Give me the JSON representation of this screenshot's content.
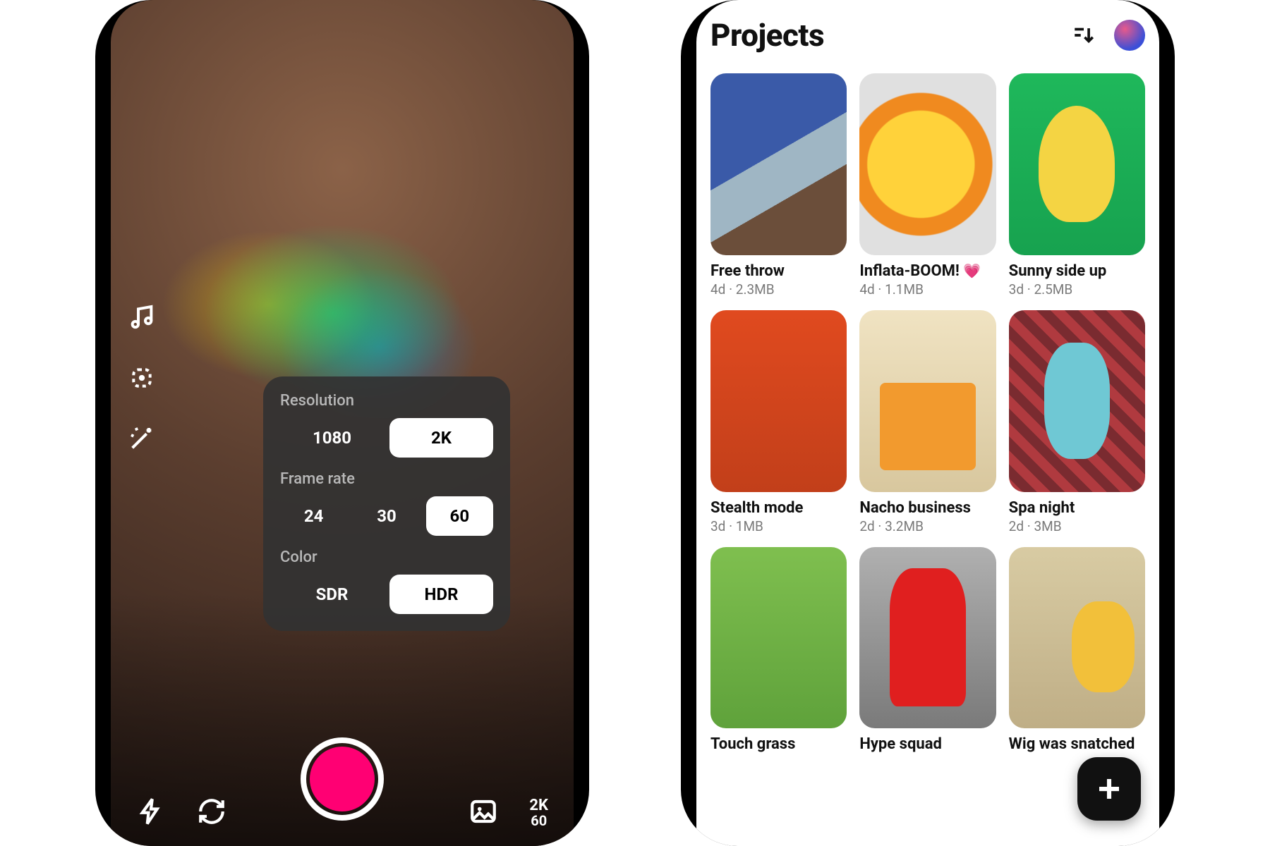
{
  "camera": {
    "sideTools": [
      "music",
      "crop-selection",
      "magic-wand"
    ],
    "settings": {
      "resolution": {
        "label": "Resolution",
        "options": [
          "1080",
          "2K"
        ],
        "selected": "2K"
      },
      "frameRate": {
        "label": "Frame rate",
        "options": [
          "24",
          "30",
          "60"
        ],
        "selected": "60"
      },
      "color": {
        "label": "Color",
        "options": [
          "SDR",
          "HDR"
        ],
        "selected": "HDR"
      }
    },
    "bottomBar": {
      "flash": "flash-icon",
      "flip": "flip-camera-icon",
      "gallery": "gallery-icon",
      "quality": {
        "line1": "2K",
        "line2": "60"
      }
    }
  },
  "projects": {
    "title": "Projects",
    "items": [
      {
        "title": "Free throw",
        "age": "4d",
        "size": "2.3MB",
        "emoji": ""
      },
      {
        "title": "Inflata-BOOM!",
        "age": "4d",
        "size": "1.1MB",
        "emoji": "💗"
      },
      {
        "title": "Sunny side up",
        "age": "3d",
        "size": "2.5MB",
        "emoji": ""
      },
      {
        "title": "Stealth mode",
        "age": "3d",
        "size": "1MB",
        "emoji": ""
      },
      {
        "title": "Nacho business",
        "age": "2d",
        "size": "3.2MB",
        "emoji": ""
      },
      {
        "title": "Spa night",
        "age": "2d",
        "size": "3MB",
        "emoji": ""
      },
      {
        "title": "Touch grass",
        "age": "",
        "size": "",
        "emoji": ""
      },
      {
        "title": "Hype squad",
        "age": "",
        "size": "",
        "emoji": ""
      },
      {
        "title": "Wig was snatched",
        "age": "",
        "size": "",
        "emoji": ""
      }
    ]
  }
}
